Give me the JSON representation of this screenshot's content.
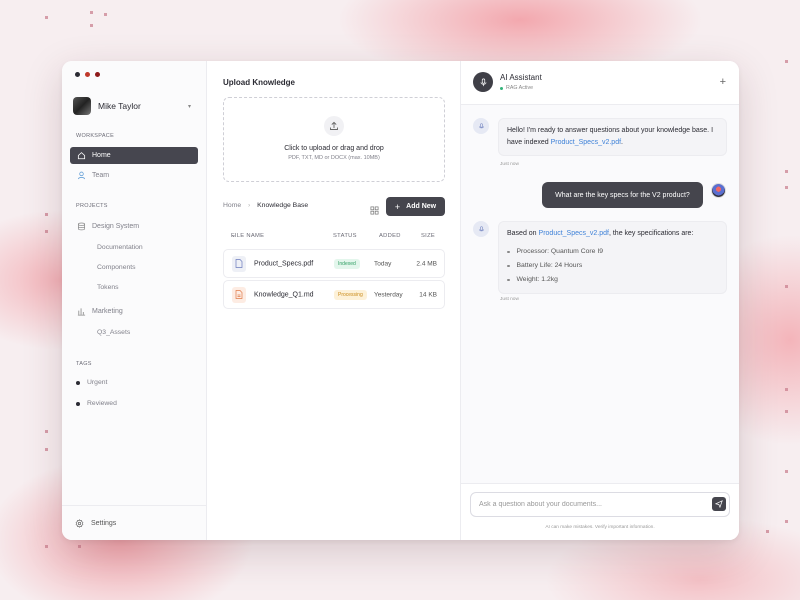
{
  "sidebar": {
    "user_name": "Mike Taylor",
    "workspace_label": "WORKSPACE",
    "workspace_items": [
      {
        "label": "Home",
        "icon": "home-icon",
        "active": true
      },
      {
        "label": "Team",
        "icon": "user-icon",
        "active": false
      }
    ],
    "projects_label": "PROJECTS",
    "projects": [
      {
        "label": "Design System",
        "icon": "database-icon",
        "children": [
          "Documentation",
          "Components",
          "Tokens"
        ]
      },
      {
        "label": "Marketing",
        "icon": "bar-chart-icon",
        "children": [
          "Q3_Assets"
        ]
      }
    ],
    "tags_label": "TAGS",
    "tags": [
      "Urgent",
      "Reviewed"
    ],
    "settings_label": "Settings"
  },
  "main": {
    "title": "Upload Knowledge",
    "dropzone": {
      "title": "Click to upload or drag and drop",
      "subtitle": "PDF, TXT, MD or DOCX (max. 10MB)"
    },
    "breadcrumb": {
      "home": "Home",
      "current": "Knowledge Base"
    },
    "add_button": "Add New",
    "table": {
      "headers": {
        "name": "FILE NAME",
        "status": "STATUS",
        "added": "ADDED",
        "size": "SIZE"
      },
      "rows": [
        {
          "name": "Product_Specs.pdf",
          "status": "Indexed",
          "added": "Today",
          "size": "2.4 MB",
          "icon": "pdf-file-icon",
          "status_color": "#2f9e63",
          "status_bg": "#e3f6ec"
        },
        {
          "name": "Knowledge_Q1.md",
          "status": "Processing",
          "added": "Yesterday",
          "size": "14 KB",
          "icon": "md-file-icon",
          "status_color": "#c98a1a",
          "status_bg": "#fdf1d8"
        }
      ]
    }
  },
  "chat": {
    "title": "AI Assistant",
    "status": "RAG Active",
    "messages": [
      {
        "role": "assistant",
        "text_before": "Hello! I'm ready to answer questions about your knowledge base. I have indexed ",
        "link": "Product_Specs_v2.pdf",
        "text_after": ".",
        "time": "Just now"
      },
      {
        "role": "user",
        "text": "What are the key specs for the V2 product?"
      },
      {
        "role": "assistant",
        "text_before": "Based on ",
        "link": "Product_Specs_v2.pdf",
        "text_after": ", the key specifications are:",
        "bullets": [
          "Processor: Quantum Core I9",
          "Battery Life: 24 Hours",
          "Weight: 1.2kg"
        ],
        "time": "Just now"
      }
    ],
    "input_placeholder": "Ask a question about your documents...",
    "disclaimer": "AI can make mistakes. Verify important information."
  },
  "colors": {
    "accent_dark": "#45454d",
    "link": "#3f82d8",
    "status_ok": "#33b37a",
    "traffic": [
      "#2b2b33",
      "#c0392b",
      "#8e1a1a"
    ]
  }
}
